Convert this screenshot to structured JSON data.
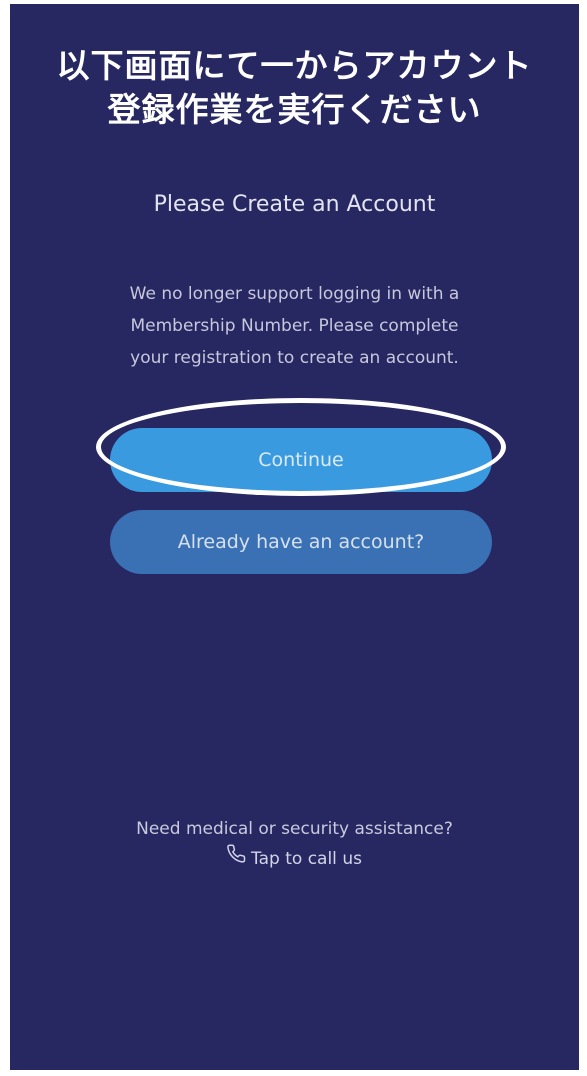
{
  "annotation": {
    "line1": "以下画面にて一からアカウント",
    "line2": "登録作業を実行ください"
  },
  "screen": {
    "title": "Please Create an Account",
    "description_lines": [
      "We no longer support logging in with a",
      "Membership Number. Please complete",
      "your registration to create an account."
    ]
  },
  "buttons": {
    "continue_label": "Continue",
    "login_label": "Already have an account?"
  },
  "help": {
    "question": "Need medical or security assistance?",
    "call_label": "Tap to call us",
    "call_icon": "phone-icon"
  },
  "colors": {
    "background": "#272762",
    "continue_button": "#3a9ae0",
    "login_button": "#3a70b4",
    "annotation_text": "#ffffff"
  }
}
